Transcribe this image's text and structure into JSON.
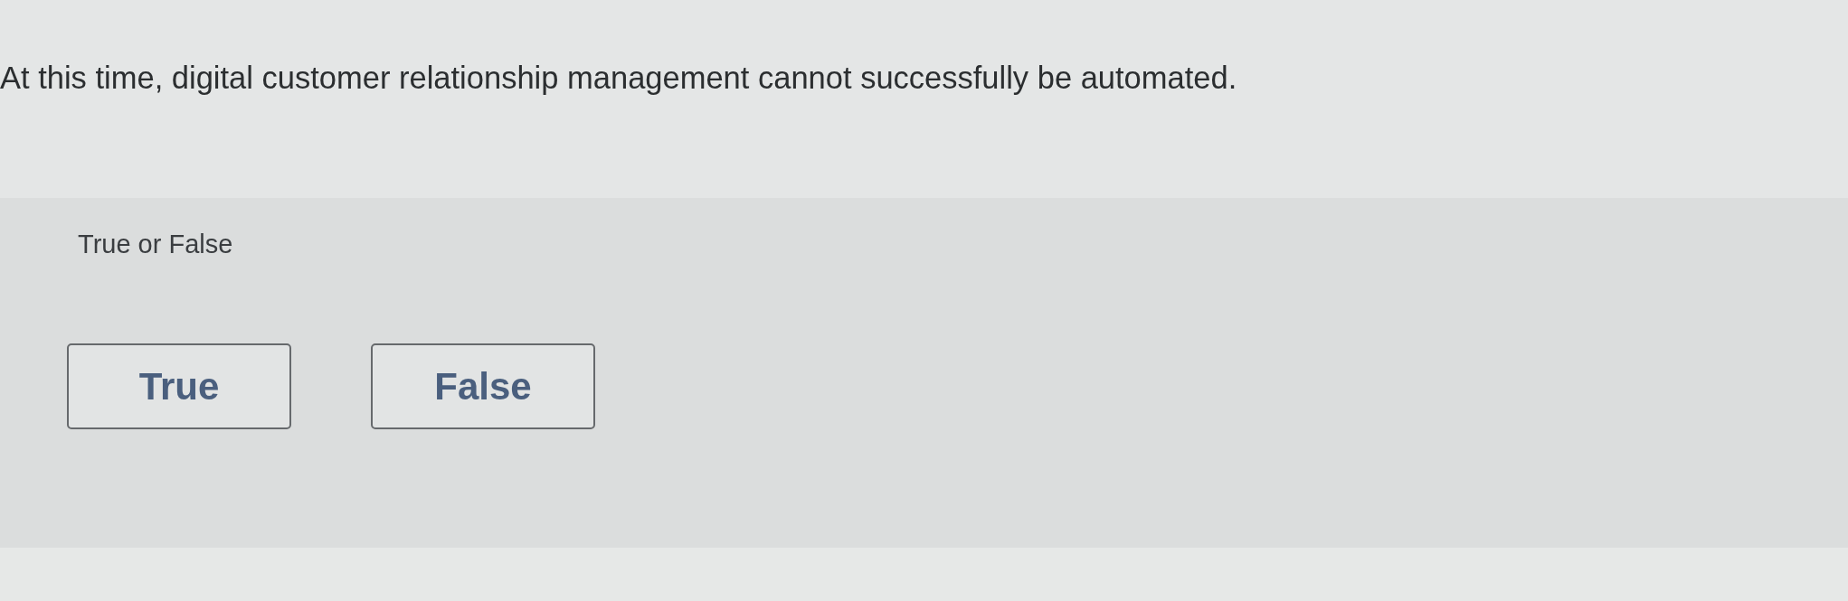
{
  "question": {
    "text": "At this time, digital customer relationship management cannot successfully be automated."
  },
  "answer_area": {
    "prompt": "True or False",
    "options": [
      {
        "label": "True",
        "selected": false
      },
      {
        "label": "False",
        "selected": false
      }
    ]
  }
}
